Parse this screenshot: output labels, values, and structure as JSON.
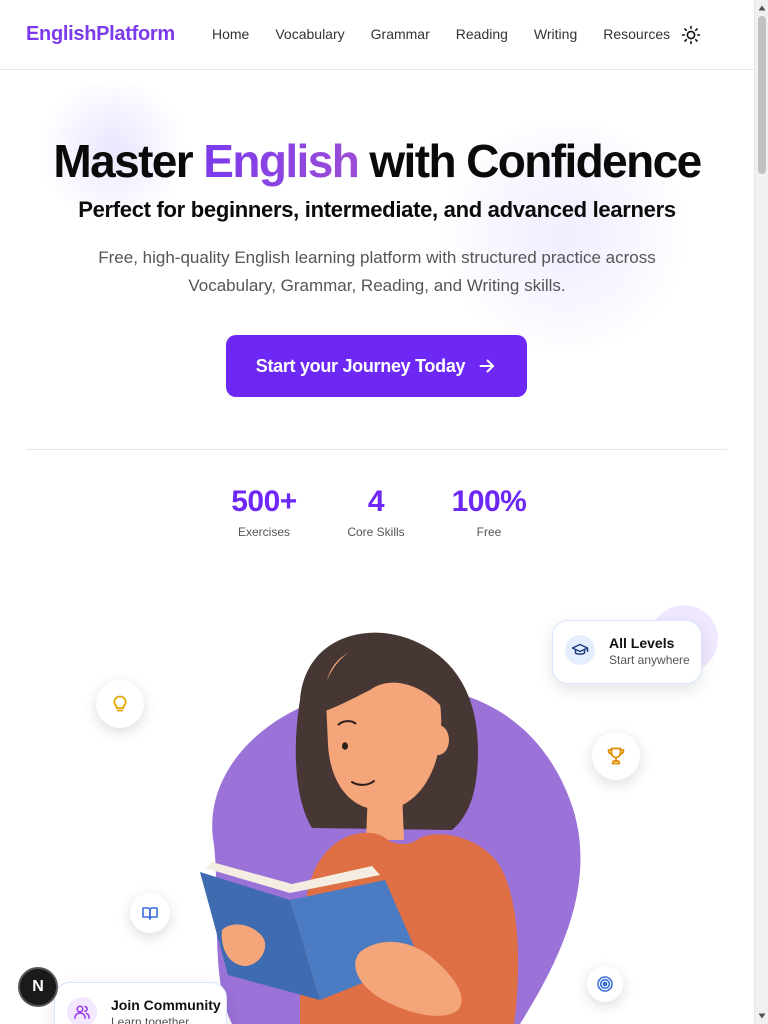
{
  "brand": "EnglishPlatform",
  "nav": [
    "Home",
    "Vocabulary",
    "Grammar",
    "Reading",
    "Writing",
    "Resources"
  ],
  "hero": {
    "title_part1": "Master ",
    "title_accent": "English",
    "title_part2": " with Confidence",
    "subtitle": "Perfect for beginners, intermediate, and advanced learners",
    "description_line1": "Free, high-quality English learning platform with structured practice across",
    "description_line2": "Vocabulary, Grammar, Reading, and Writing skills.",
    "cta_label": "Start your Journey Today"
  },
  "stats": [
    {
      "value": "500+",
      "label": "Exercises"
    },
    {
      "value": "4",
      "label": "Core Skills"
    },
    {
      "value": "100%",
      "label": "Free"
    }
  ],
  "cards": {
    "levels": {
      "title": "All Levels",
      "subtitle": "Start anywhere"
    },
    "community": {
      "title": "Join Community",
      "subtitle": "Learn together"
    }
  },
  "badge": "N",
  "colors": {
    "accent": "#6d28f5",
    "brand": "#7c3aed",
    "blob": "#9b72d8",
    "shirt": "#df6f44",
    "book": "#3f6cb0"
  },
  "icons": {
    "theme": "sun-icon",
    "cta": "arrow-right-icon",
    "levels": "graduation-cap-icon",
    "community": "users-icon",
    "bubbles": [
      "lightbulb-icon",
      "trophy-icon",
      "book-open-icon",
      "target-icon"
    ]
  }
}
